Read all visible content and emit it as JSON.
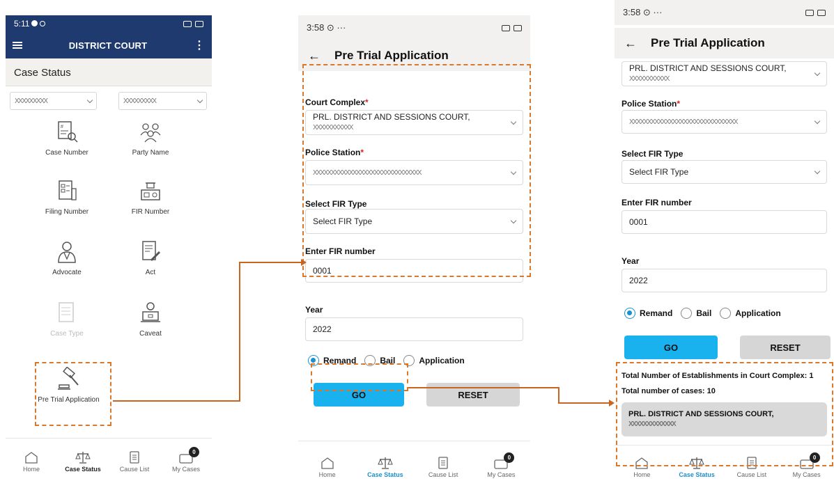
{
  "phone1": {
    "status_time": "5:11",
    "app_title": "DISTRICT COURT",
    "section_title": "Case Status",
    "select_left": "XXXXXXXXX",
    "select_right": "XXXXXXXXX",
    "tiles": [
      {
        "label": "Case Number",
        "icon": "case-number-icon"
      },
      {
        "label": "Party Name",
        "icon": "party-name-icon"
      },
      {
        "label": "Filing Number",
        "icon": "filing-number-icon"
      },
      {
        "label": "FIR Number",
        "icon": "fir-number-icon"
      },
      {
        "label": "Advocate",
        "icon": "advocate-icon"
      },
      {
        "label": "Act",
        "icon": "act-icon"
      },
      {
        "label": "Case Type",
        "icon": "case-type-icon"
      },
      {
        "label": "Caveat",
        "icon": "caveat-icon"
      },
      {
        "label": "Pre Trial Application",
        "icon": "gavel-icon"
      }
    ],
    "nav": [
      {
        "label": "Home"
      },
      {
        "label": "Case Status"
      },
      {
        "label": "Cause List"
      },
      {
        "label": "My Cases",
        "badge": "0"
      }
    ]
  },
  "phone2": {
    "status_time": "3:58",
    "title": "Pre Trial Application",
    "court_complex_label": "Court Complex",
    "court_complex_value": "PRL. DISTRICT AND SESSIONS COURT,",
    "court_complex_value2": "XXXXXXXXXXX",
    "police_station_label": "Police Station",
    "police_station_value": "XXXXXXXXXXXXXXXXXXXXXXXXXXXXXX",
    "fir_type_label": "Select FIR Type",
    "fir_type_placeholder": "Select FIR Type",
    "fir_number_label": "Enter FIR number",
    "fir_number_value": "0001",
    "year_label": "Year",
    "year_value": "2022",
    "radio_remand": "Remand",
    "radio_bail": "Bail",
    "radio_application": "Application",
    "go_label": "GO",
    "reset_label": "RESET",
    "nav": [
      {
        "label": "Home"
      },
      {
        "label": "Case Status"
      },
      {
        "label": "Cause List"
      },
      {
        "label": "My Cases",
        "badge": "0"
      }
    ]
  },
  "phone3": {
    "status_time": "3:58",
    "title": "Pre Trial Application",
    "court_complex_value": "PRL. DISTRICT AND SESSIONS COURT,",
    "court_complex_value2": "XXXXXXXXXXX",
    "police_station_label": "Police Station",
    "police_station_value": "XXXXXXXXXXXXXXXXXXXXXXXXXXXXXX",
    "fir_type_label": "Select FIR Type",
    "fir_type_placeholder": "Select FIR Type",
    "fir_number_label": "Enter FIR number",
    "fir_number_value": "0001",
    "year_label": "Year",
    "year_value": "2022",
    "radio_remand": "Remand",
    "radio_bail": "Bail",
    "radio_application": "Application",
    "go_label": "GO",
    "reset_label": "RESET",
    "total_establishments": "Total Number of Establishments in Court Complex: 1",
    "total_cases": "Total number of cases: 10",
    "court_card_line1": "PRL. DISTRICT AND SESSIONS COURT,",
    "court_card_line2": "XXXXXXXXXXXXX",
    "nav": [
      {
        "label": "Home"
      },
      {
        "label": "Case Status"
      },
      {
        "label": "Cause List"
      },
      {
        "label": "My Cases",
        "badge": "0"
      }
    ]
  },
  "colors": {
    "appbar_blue": "#1e3a6e",
    "accent_blue": "#1ab1ef",
    "annotation_orange": "#d9772b",
    "required_red": "#d22"
  }
}
